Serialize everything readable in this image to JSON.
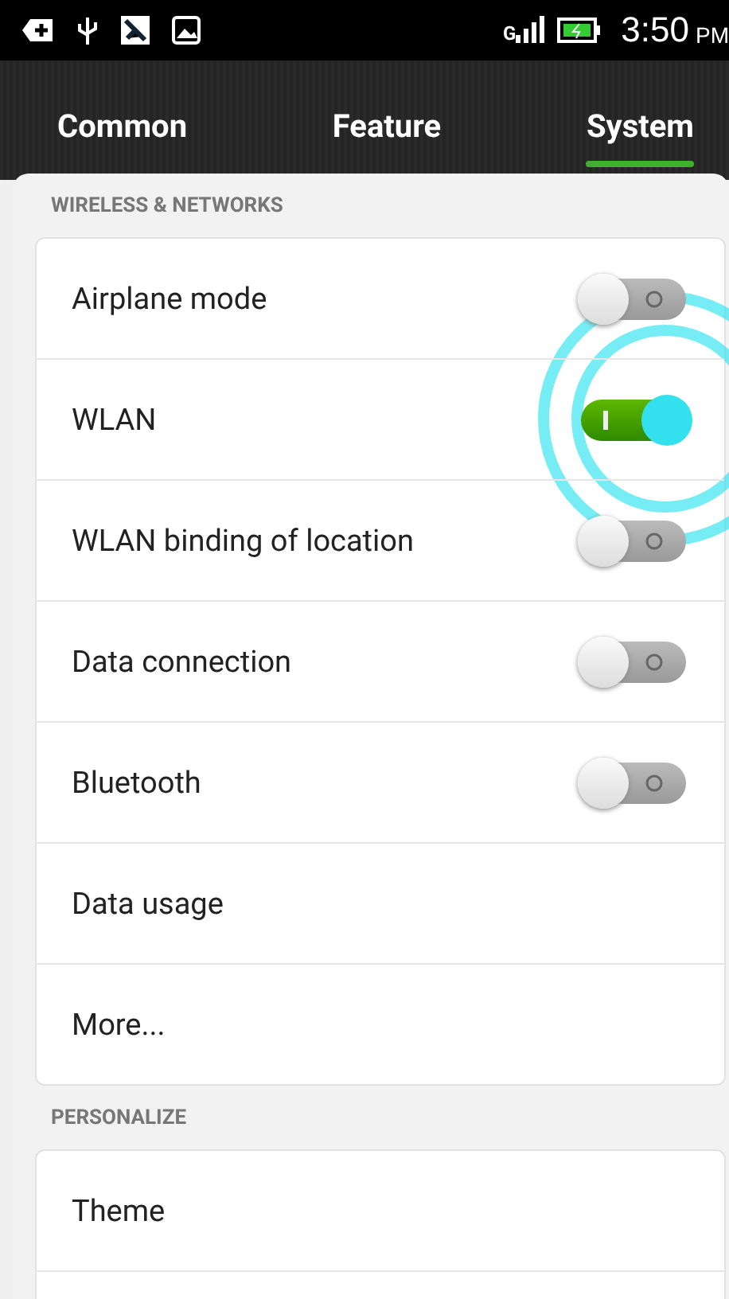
{
  "status_bar": {
    "network": "G",
    "time": "3:50",
    "ampm": "PM"
  },
  "tabs": [
    {
      "label": "Common",
      "selected": false
    },
    {
      "label": "Feature",
      "selected": false
    },
    {
      "label": "System",
      "selected": true
    }
  ],
  "sections": [
    {
      "title": "WIRELESS & NETWORKS",
      "rows": [
        {
          "kind": "switch",
          "label": "Airplane mode",
          "on": false,
          "pressed": false
        },
        {
          "kind": "switch",
          "label": "WLAN",
          "on": true,
          "pressed": true
        },
        {
          "kind": "switch",
          "label": "WLAN binding of location",
          "on": false,
          "pressed": false
        },
        {
          "kind": "switch",
          "label": "Data connection",
          "on": false,
          "pressed": false
        },
        {
          "kind": "switch",
          "label": "Bluetooth",
          "on": false,
          "pressed": false
        },
        {
          "kind": "link",
          "label": "Data usage"
        },
        {
          "kind": "link",
          "label": "More..."
        }
      ]
    },
    {
      "title": "PERSONALIZE",
      "rows": [
        {
          "kind": "link",
          "label": "Theme"
        },
        {
          "kind": "link"
        }
      ]
    }
  ]
}
